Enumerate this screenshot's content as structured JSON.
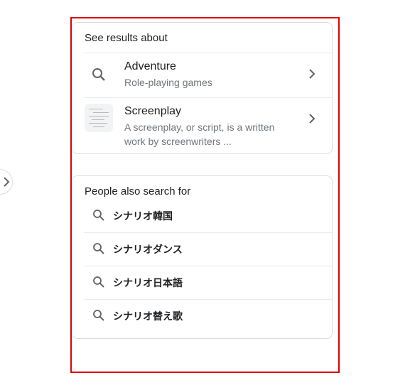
{
  "colors": {
    "frame": "#e00000",
    "border": "#dadce0",
    "muted": "#70757a",
    "text": "#202124"
  },
  "see_results": {
    "title": "See results about",
    "items": [
      {
        "title": "Adventure",
        "subtitle": "Role-playing games",
        "icon": "search-icon"
      },
      {
        "title": "Screenplay",
        "subtitle": "A screenplay, or script, is a written work by screenwriters ...",
        "icon": "screenplay-thumbnail"
      }
    ]
  },
  "people_also_search": {
    "title": "People also search for",
    "items": [
      {
        "label": "シナリオ韓国"
      },
      {
        "label": "シナリオダンス"
      },
      {
        "label": "シナリオ日本語"
      },
      {
        "label": "シナリオ替え歌"
      }
    ]
  }
}
